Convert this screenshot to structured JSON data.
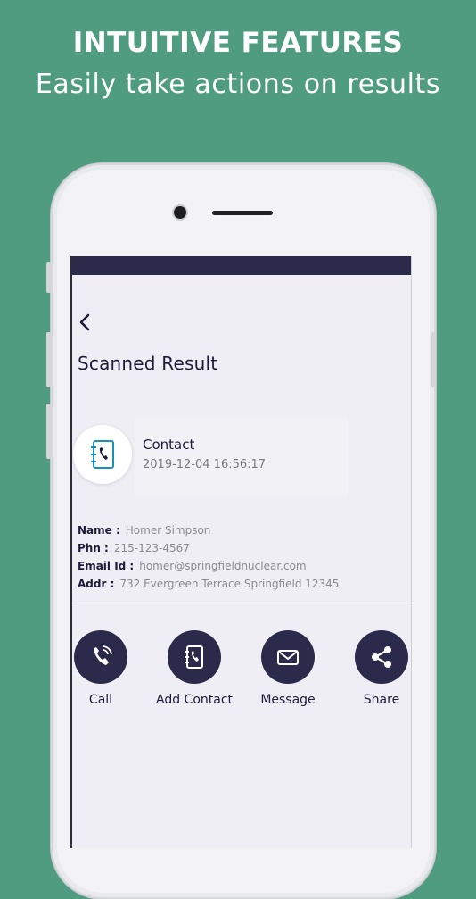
{
  "promo": {
    "headline": "INTUITIVE FEATURES",
    "subline": "Easily take actions on results"
  },
  "colors": {
    "background": "#509c80",
    "accent": "#2c2a4a",
    "screen_bg": "#efeef5"
  },
  "screen": {
    "title": "Scanned Result",
    "back_icon": "chevron-left-icon",
    "result": {
      "icon": "contact-book-icon",
      "type": "Contact",
      "timestamp": "2019-12-04 16:56:17"
    },
    "details": [
      {
        "key": "Name :",
        "value": "Homer Simpson"
      },
      {
        "key": "Phn :",
        "value": "215-123-4567"
      },
      {
        "key": "Email Id :",
        "value": "homer@springfieldnuclear.com"
      },
      {
        "key": "Addr :",
        "value": "732 Evergreen Terrace Springfield 12345"
      }
    ],
    "actions": [
      {
        "label": "Call",
        "icon": "phone-icon"
      },
      {
        "label": "Add Contact",
        "icon": "add-contact-icon"
      },
      {
        "label": "Message",
        "icon": "envelope-icon"
      },
      {
        "label": "Share",
        "icon": "share-icon"
      }
    ]
  }
}
